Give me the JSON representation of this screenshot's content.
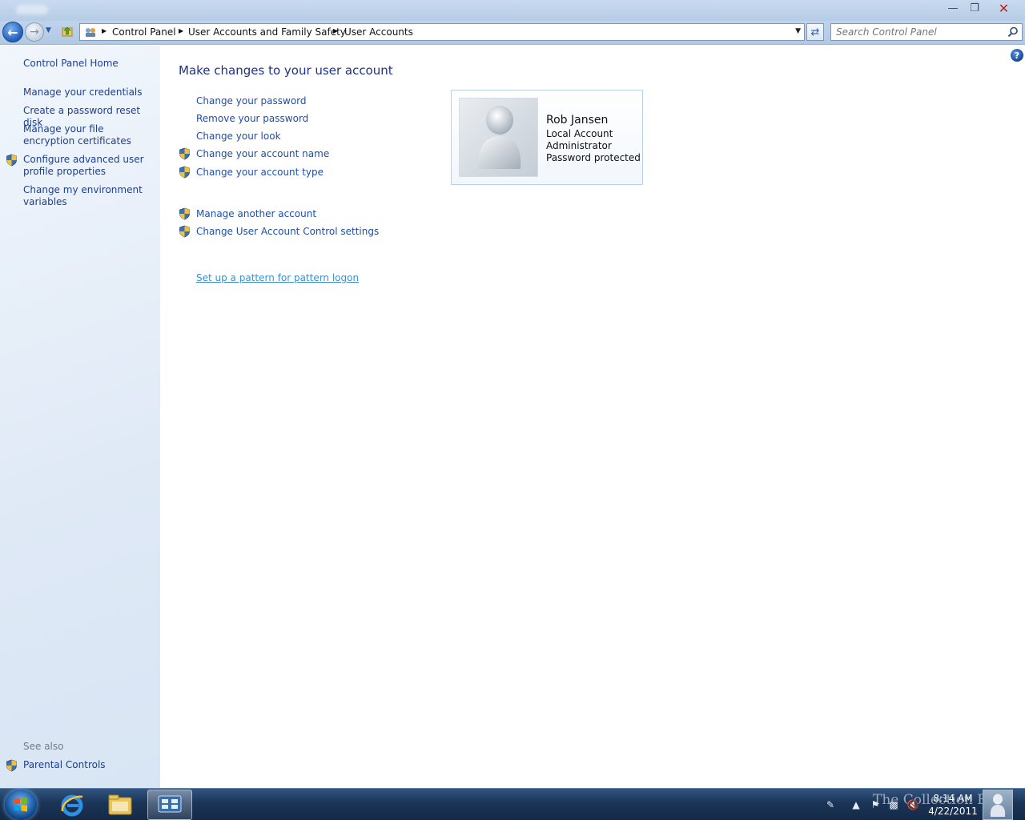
{
  "window": {
    "caption_buttons": {
      "minimize": "minimize-icon",
      "maximize": "restore-icon",
      "close": "close-icon"
    }
  },
  "navigation": {
    "breadcrumb": [
      "Control Panel",
      "User Accounts and Family Safety",
      "User Accounts"
    ],
    "search": {
      "placeholder": "Search Control Panel",
      "value": ""
    }
  },
  "sidebar": {
    "home": "Control Panel Home",
    "links": [
      {
        "label": "Manage your credentials",
        "shield": false
      },
      {
        "label": "Create a password reset disk",
        "shield": false
      },
      {
        "label": "Manage your file encryption certificates",
        "shield": false
      },
      {
        "label": "Configure advanced user profile properties",
        "shield": true
      },
      {
        "label": "Change my environment variables",
        "shield": false
      }
    ],
    "see_also_heading": "See also",
    "see_also": [
      {
        "label": "Parental Controls",
        "shield": true
      }
    ]
  },
  "main": {
    "title": "Make changes to your user account",
    "account_tasks": [
      {
        "label": "Change your password",
        "shield": false
      },
      {
        "label": "Remove your password",
        "shield": false
      },
      {
        "label": "Change your look",
        "shield": false
      },
      {
        "label": "Change your account name",
        "shield": true
      },
      {
        "label": "Change your account type",
        "shield": true
      }
    ],
    "other_tasks": [
      {
        "label": "Manage another account",
        "shield": true
      },
      {
        "label": "Change User Account Control settings",
        "shield": true
      }
    ],
    "pattern_link": "Set up a pattern for pattern logon",
    "account": {
      "name": "Rob Jansen",
      "type": "Local Account",
      "role": "Administrator",
      "status": "Password protected"
    }
  },
  "taskbar": {
    "pinned": [
      "internet-explorer-icon",
      "windows-explorer-icon",
      "control-panel-icon"
    ],
    "active": "control-panel-icon",
    "clock": {
      "time": "8:14 AM",
      "date": "4/22/2011"
    },
    "watermark": "The Collection Book"
  },
  "colors": {
    "link": "#1e4fa8",
    "title": "#1e3287",
    "sidebar_bg": "#dfe9f6",
    "taskbar": "#1b3457",
    "close_accent": "#b0281e"
  }
}
